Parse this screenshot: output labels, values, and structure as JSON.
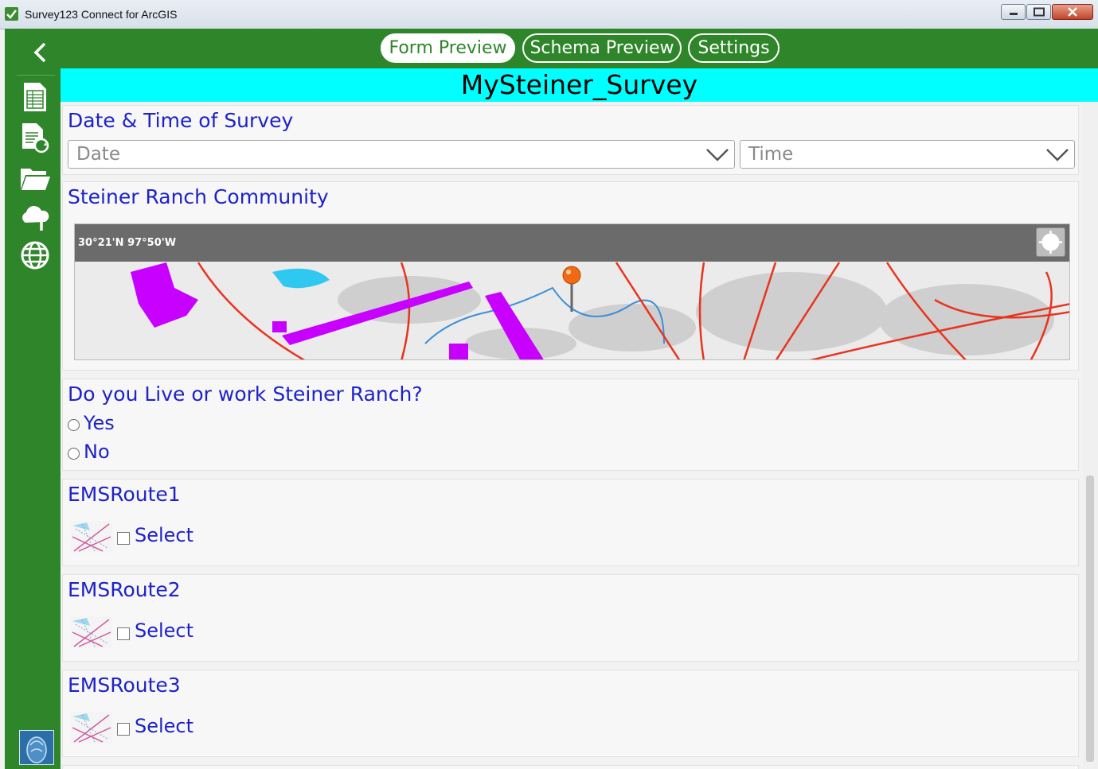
{
  "window": {
    "title": "Survey123 Connect for ArcGIS"
  },
  "header": {
    "tabs": [
      {
        "label": "Form Preview",
        "active": true
      },
      {
        "label": "Schema Preview",
        "active": false
      },
      {
        "label": "Settings",
        "active": false
      }
    ]
  },
  "sidebar": {
    "icons": [
      "back-arrow-icon",
      "form-list-icon",
      "refresh-form-icon",
      "folder-icon",
      "cloud-upload-icon",
      "globe-icon",
      "user-avatar"
    ]
  },
  "survey": {
    "title": "MySteiner_Survey",
    "questions": {
      "datetime": {
        "label": "Date & Time of Survey",
        "date_placeholder": "Date",
        "time_placeholder": "Time"
      },
      "community": {
        "label": "Steiner Ranch Community",
        "coords": "30°21'N 97°50'W"
      },
      "live_work": {
        "label": "Do you Live or work Steiner Ranch?",
        "options": [
          "Yes",
          "No"
        ]
      },
      "routes": [
        {
          "label": "EMSRoute1",
          "option": "Select"
        },
        {
          "label": "EMSRoute2",
          "option": "Select"
        },
        {
          "label": "EMSRoute3",
          "option": "Select"
        }
      ]
    }
  },
  "colors": {
    "sidebar": "#2f862a",
    "title_bar": "#00ffff",
    "label_text": "#1e22c8"
  }
}
